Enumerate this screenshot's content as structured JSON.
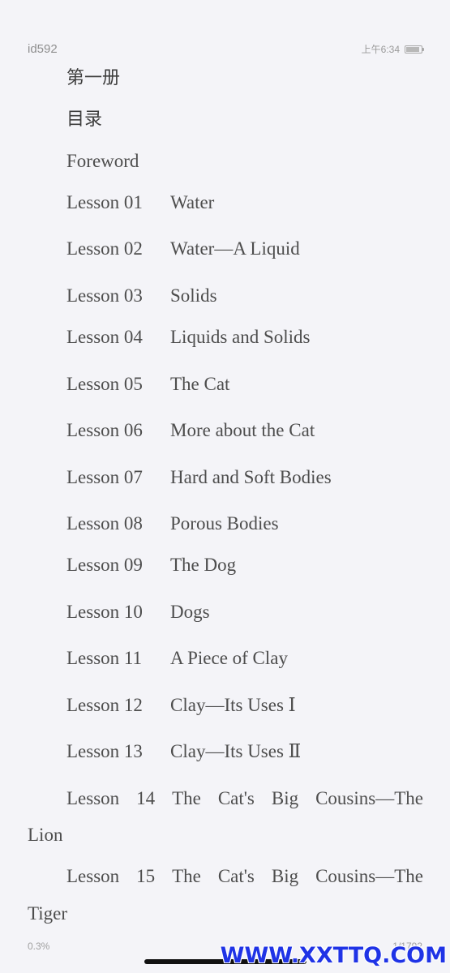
{
  "status_bar": {
    "book_id": "id592",
    "time": "上午6:34",
    "battery_icon": "battery-icon"
  },
  "book": {
    "volume": "第一册",
    "toc_heading": "目录",
    "foreword": "Foreword",
    "lessons": [
      {
        "number": "Lesson 01",
        "title": "Water"
      },
      {
        "number": "Lesson 02",
        "title": "Water—A Liquid"
      },
      {
        "number": "Lesson 03",
        "title": "Solids"
      },
      {
        "number": "Lesson 04",
        "title": "Liquids and Solids"
      },
      {
        "number": "Lesson 05",
        "title": "The Cat"
      },
      {
        "number": "Lesson 06",
        "title": "More about the Cat"
      },
      {
        "number": "Lesson 07",
        "title": "Hard and Soft Bodies"
      },
      {
        "number": "Lesson 08",
        "title": "Porous Bodies"
      },
      {
        "number": "Lesson 09",
        "title": "The Dog"
      },
      {
        "number": "Lesson 10",
        "title": "Dogs"
      },
      {
        "number": "Lesson 11",
        "title": "A Piece of Clay"
      },
      {
        "number": "Lesson 12",
        "title": "Clay—Its Uses Ⅰ"
      },
      {
        "number": "Lesson 13",
        "title": "Clay—Its Uses Ⅱ"
      }
    ],
    "wrapped_lessons": [
      {
        "line1": [
          "Lesson",
          "14",
          "The",
          "Cat's",
          "Big",
          "Cousins—The"
        ],
        "line2": "Lion"
      },
      {
        "line1": [
          "Lesson",
          "15",
          "The",
          "Cat's",
          "Big",
          "Cousins—The"
        ],
        "line2": "Tiger"
      }
    ]
  },
  "footer": {
    "progress": "0.3%",
    "page_count": "1/1792"
  },
  "watermark": "WWW.XXTTQ.COM"
}
